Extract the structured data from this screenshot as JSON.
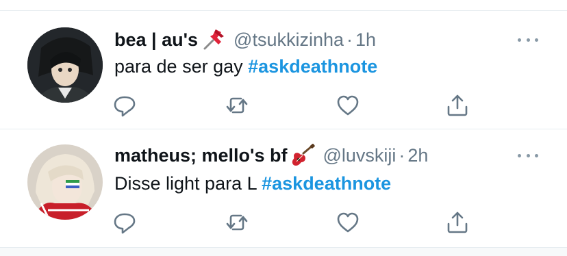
{
  "tweets": [
    {
      "name": "bea | au's",
      "emoji": "pushpin-emoji",
      "handle": "@tsukkizinha",
      "separator": "·",
      "time": "1h",
      "text": "para de ser gay",
      "hashtag": "#askdeathnote",
      "avatar": "avatar-image"
    },
    {
      "name": "matheus; mello's bf",
      "emoji": "guitar-emoji",
      "handle": "@luvskiji",
      "separator": "·",
      "time": "2h",
      "text": "Disse light para L",
      "hashtag": "#askdeathnote",
      "avatar": "avatar-image"
    }
  ],
  "icons": {
    "reply": "reply-icon",
    "retweet": "retweet-icon",
    "like": "heart-icon",
    "share": "share-icon",
    "more": "more-dots-icon"
  },
  "colors": {
    "hashtag": "#1b95e0",
    "secondary_text": "#657786",
    "icon": "#657786",
    "divider": "#e6ecf0"
  }
}
